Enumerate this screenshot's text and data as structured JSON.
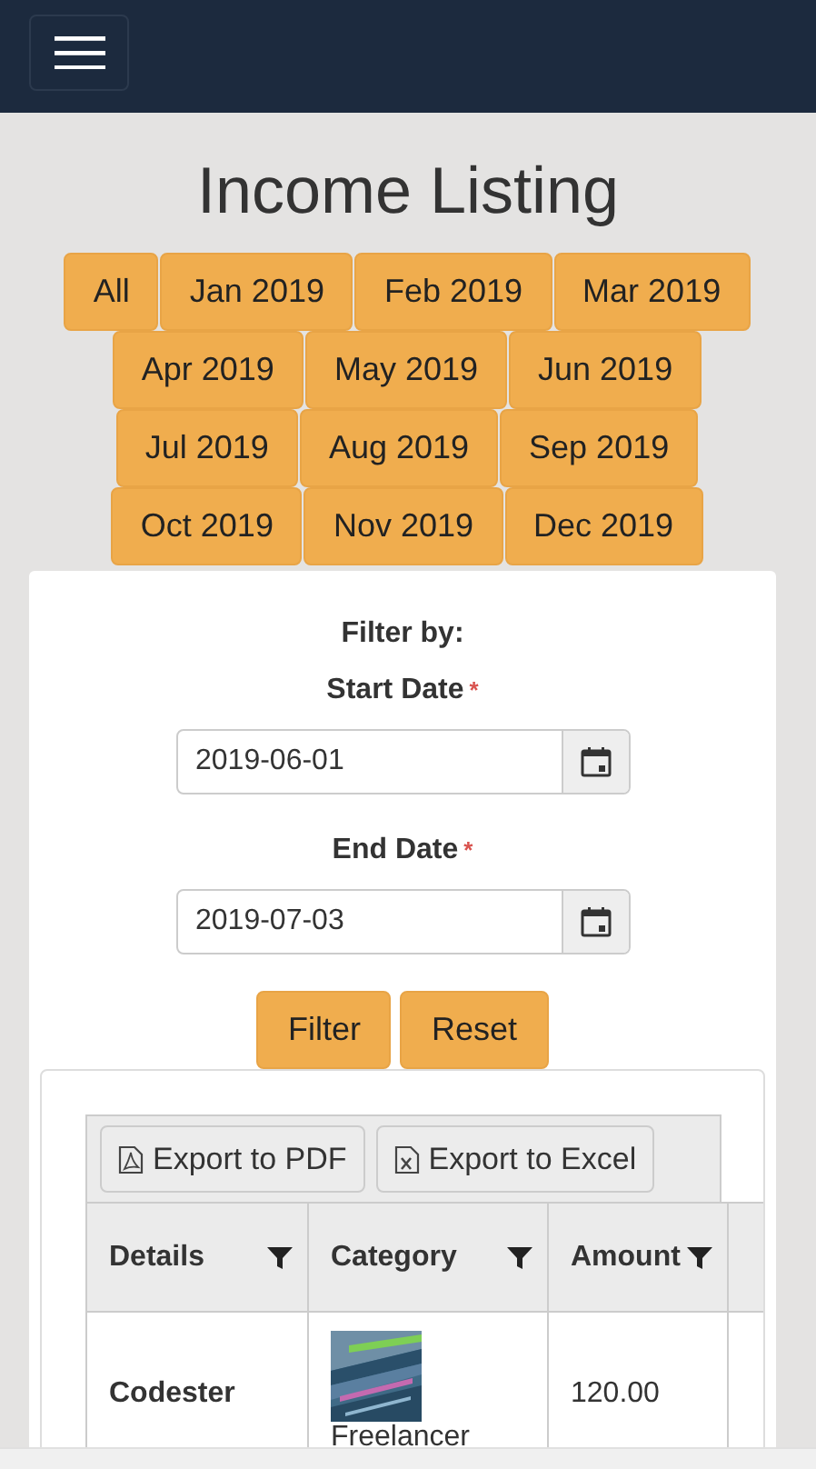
{
  "title": "Income Listing",
  "months": [
    "All",
    "Jan 2019",
    "Feb 2019",
    "Mar 2019",
    "Apr 2019",
    "May 2019",
    "Jun 2019",
    "Jul 2019",
    "Aug 2019",
    "Sep 2019",
    "Oct 2019",
    "Nov 2019",
    "Dec 2019"
  ],
  "filter": {
    "heading": "Filter by:",
    "fields": [
      {
        "label": "Start Date",
        "required_mark": "*",
        "value": "2019-06-01"
      },
      {
        "label": "End Date",
        "required_mark": "*",
        "value": "2019-07-03"
      }
    ],
    "buttons": [
      "Filter",
      "Reset"
    ]
  },
  "toolbar": [
    {
      "kind": "pdf",
      "label": "Export to PDF"
    },
    {
      "kind": "excel",
      "label": "Export to Excel"
    }
  ],
  "table": {
    "columns": [
      "Details",
      "Category",
      "Amount"
    ],
    "rows": [
      {
        "details": "Codester",
        "category": {
          "label": "Freelancer"
        },
        "amount": "120.00"
      }
    ]
  }
}
